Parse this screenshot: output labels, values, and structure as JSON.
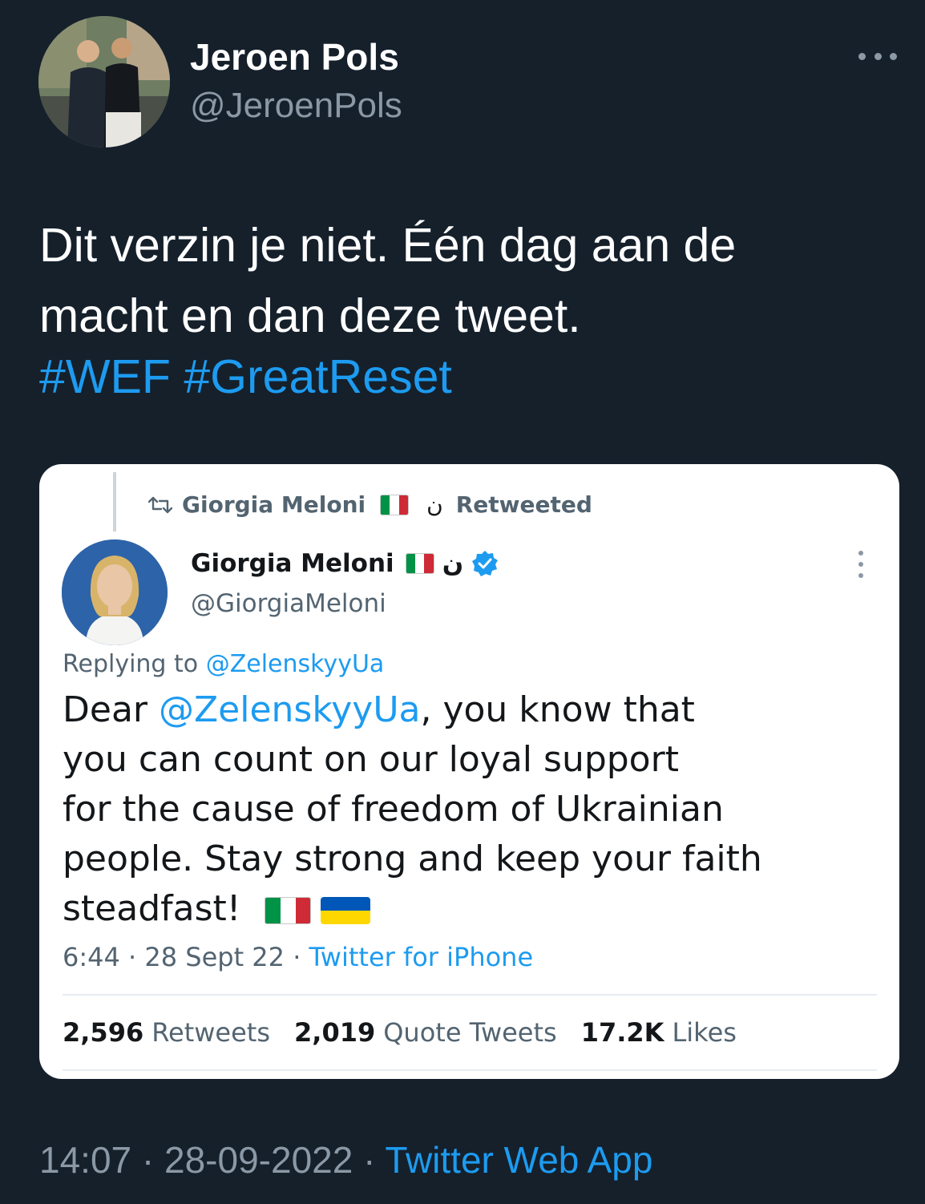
{
  "author": {
    "name": "Jeroen Pols",
    "handle": "@JeroenPols"
  },
  "tweet": {
    "lines": [
      "Dit verzin je niet. Één dag aan de",
      "macht en dan deze tweet."
    ],
    "hashtags": [
      "#WEF",
      "#GreatReset"
    ]
  },
  "embedded": {
    "retweet_by": "Giorgia Meloni",
    "retweet_label": "Retweeted",
    "nun_glyph": "ن",
    "name": "Giorgia Meloni",
    "handle": "@GiorgiaMeloni",
    "replying_label": "Replying to",
    "replying_to": "@ZelenskyyUa",
    "body_dear": "Dear",
    "body_mention": "@ZelenskyyUa",
    "body_rest": ", you know that",
    "body_lines": [
      "you can count on our loyal support",
      "for the cause of freedom of Ukrainian",
      "people. Stay strong and keep your faith"
    ],
    "body_last": "steadfast!",
    "time": "6:44",
    "date": "28 Sept 22",
    "source": "Twitter for iPhone",
    "stats": {
      "retweets_count": "2,596",
      "retweets_label": "Retweets",
      "quotes_count": "2,019",
      "quotes_label": "Quote Tweets",
      "likes_count": "17.2K",
      "likes_label": "Likes"
    },
    "colors": {
      "italy": [
        "#009246",
        "#ffffff",
        "#ce2b37"
      ],
      "ukraine": [
        "#0057b7",
        "#ffd700"
      ],
      "verified": "#1d9bf0"
    }
  },
  "footer": {
    "time": "14:07",
    "date": "28-09-2022",
    "source": "Twitter Web App"
  }
}
